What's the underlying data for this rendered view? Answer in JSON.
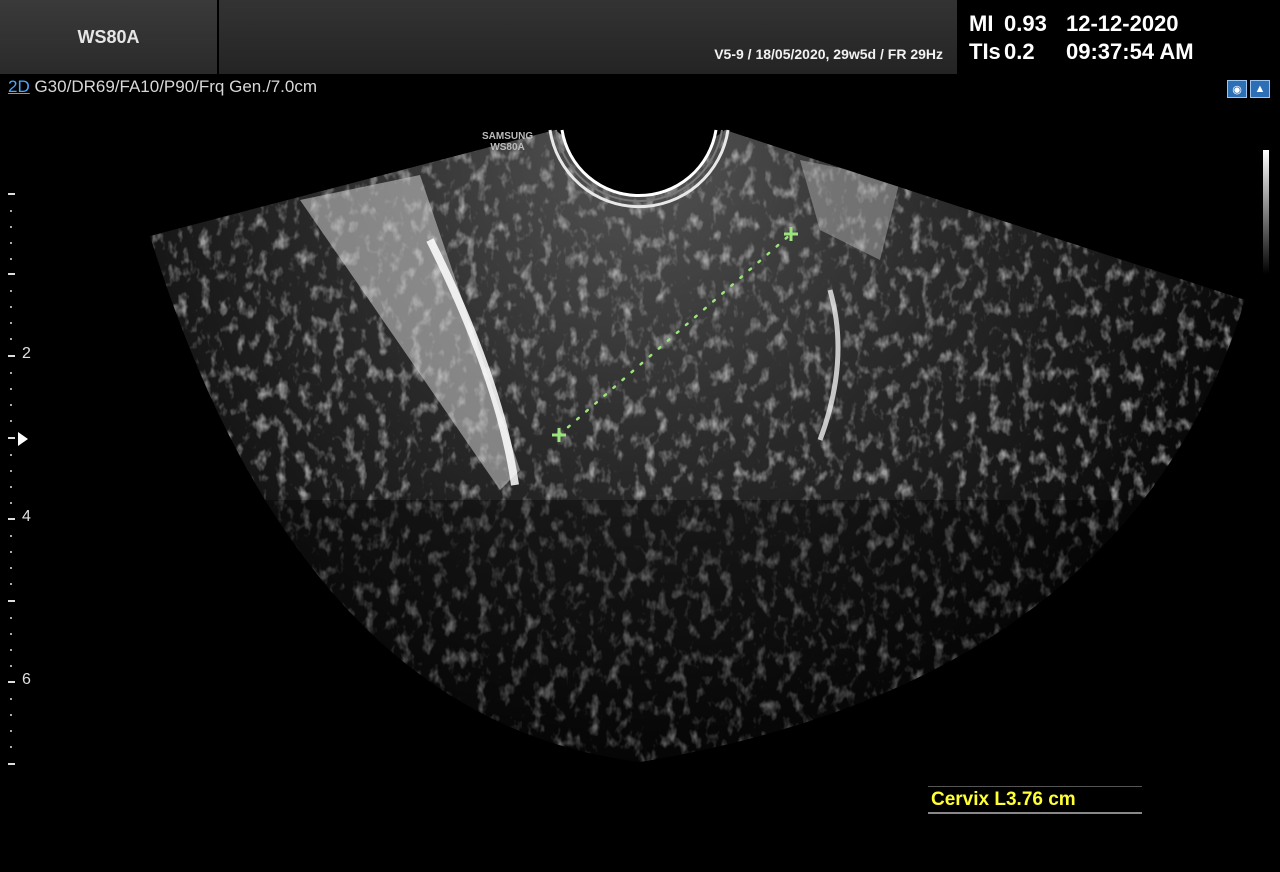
{
  "header": {
    "model": "WS80A",
    "probe_info": "V5-9 / 18/05/2020, 29w5d / FR 29Hz",
    "mi_label": "MI",
    "mi_value": "0.93",
    "tis_label": "TIs",
    "tis_value": "0.2",
    "date": "12-12-2020",
    "time": "09:37:54 AM"
  },
  "param_line": {
    "mode": "2D",
    "settings": " G30/DR69/FA10/P90/Frq Gen./7.0cm"
  },
  "watermark": {
    "line1": "SAMSUNG",
    "line2": "WS80A"
  },
  "depth_scale": {
    "labels": [
      "2",
      "4",
      "6"
    ]
  },
  "measurement": {
    "label": "Cervix L",
    "value": "3.76 cm"
  },
  "colors": {
    "mode_accent": "#4aa8ff",
    "measurement_text": "#ffff33",
    "caliper": "#9be37a"
  }
}
